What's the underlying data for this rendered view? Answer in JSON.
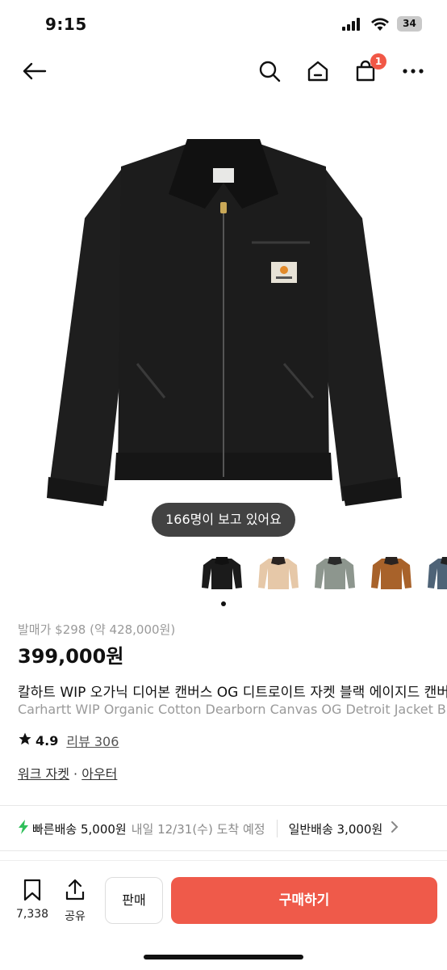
{
  "status_bar": {
    "time": "9:15",
    "battery": "34"
  },
  "nav": {
    "cart_badge": "1"
  },
  "viewers_text": "166명이 보고 있어요",
  "thumbnails": [
    {
      "color": "#1b1b1b",
      "collar": "#222"
    },
    {
      "color": "#e6c8a8",
      "collar": "#2a2320"
    },
    {
      "color": "#8d968e",
      "collar": "#2a2a2a"
    },
    {
      "color": "#a8622a",
      "collar": "#2a2320"
    },
    {
      "color": "#4e6377",
      "collar": "#222"
    }
  ],
  "product": {
    "original_price": "발매가 $298 (약 428,000원)",
    "price": "399,000원",
    "title_ko": "칼하트 WIP 오가닉 디어본 캔버스 OG 디트로이트 자켓 블랙 에이지드 캔버스",
    "title_en": "Carhartt WIP Organic Cotton Dearborn Canvas OG Detroit Jacket Black Aged Canvas",
    "rating": "4.9",
    "review_label": "리뷰 306",
    "category_1": "워크 자켓",
    "category_sep": " · ",
    "category_2": "아우터"
  },
  "shipping": {
    "fast_label": "빠른배송 5,000원",
    "fast_eta": "내일 12/31(수) 도착 예정",
    "normal_label": "일반배송 3,000원"
  },
  "bottom_bar": {
    "wishlist_count": "7,338",
    "share_label": "공유",
    "sell_label": "판매",
    "buy_label": "구매하기"
  },
  "colors": {
    "accent": "#ef5a4a",
    "badge": "#f15746",
    "bolt": "#2fbf5a"
  }
}
